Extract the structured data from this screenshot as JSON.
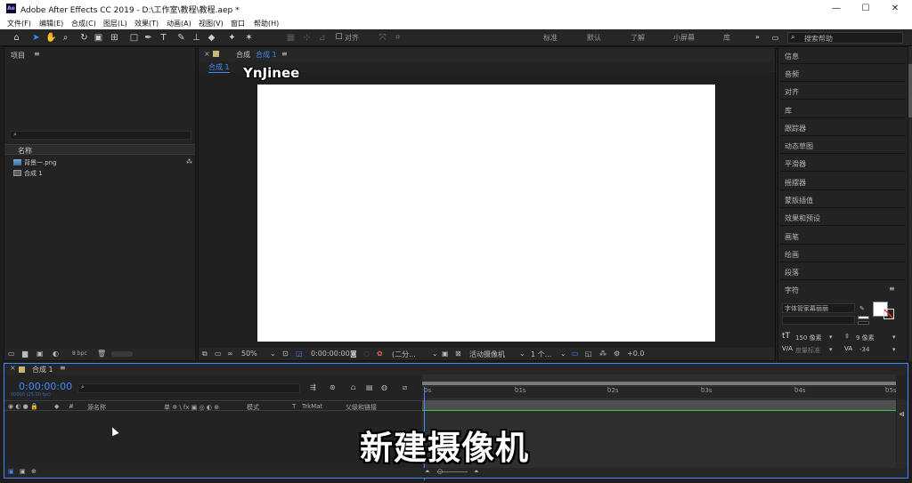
{
  "window": {
    "title": "Adobe After Effects CC 2019 - D:\\工作室\\教程\\教程.aep *",
    "app_badge": "Ae",
    "minimize": "—",
    "maximize": "☐",
    "close": "✕"
  },
  "menu": [
    "文件(F)",
    "编辑(E)",
    "合成(C)",
    "图层(L)",
    "效果(T)",
    "动画(A)",
    "视图(V)",
    "窗口",
    "帮助(H)"
  ],
  "toolbar": {
    "align_label": "对齐",
    "workspaces": [
      "标准",
      "默认",
      "了解",
      "小屏幕",
      "库"
    ],
    "more": "»",
    "search_placeholder": "搜索帮助"
  },
  "project": {
    "tab_label": "项目",
    "column_name": "名称",
    "items": [
      {
        "name": "背景一.png",
        "icon": "image-icon"
      },
      {
        "name": "合成 1",
        "icon": "composition-icon"
      }
    ],
    "bpc": "8 bpc"
  },
  "viewer": {
    "tab_label": "合成",
    "tab_comp": "合成 1",
    "sub_tab": "合成 1",
    "zoom": "50%",
    "timecode": "0:00:00:00",
    "resolution": "(二分...",
    "camera": "活动摄像机",
    "views": "1 个...",
    "exposure": "+0.0",
    "frame_color": "#ffffff"
  },
  "right_panels": [
    "信息",
    "音频",
    "对齐",
    "库",
    "跟踪器",
    "动态草图",
    "平滑器",
    "摇摆器",
    "蒙版插值",
    "效果和预设",
    "画笔",
    "绘画",
    "段落"
  ],
  "character": {
    "title": "字符",
    "font": "字体管家幕丽丽",
    "size": "150 像素",
    "leading": "9 像素",
    "kerning": "度量标准",
    "tracking": "-34"
  },
  "timeline": {
    "tab_label": "合成 1",
    "timecode": "0:00:00:00",
    "timecode_sub": "00000 (25.00 fps)",
    "columns": [
      "#",
      "源名称",
      "单 ✲ \\ fx ▣ ◎ ◐ ⊕",
      "模式",
      "T",
      "TrkMat",
      "父级和链接"
    ],
    "ruler": [
      "0s",
      "01s",
      "02s",
      "03s",
      "04s",
      "05s"
    ]
  },
  "overlay": {
    "subtitle": "新建摄像机",
    "watermark": "YnJinee"
  }
}
